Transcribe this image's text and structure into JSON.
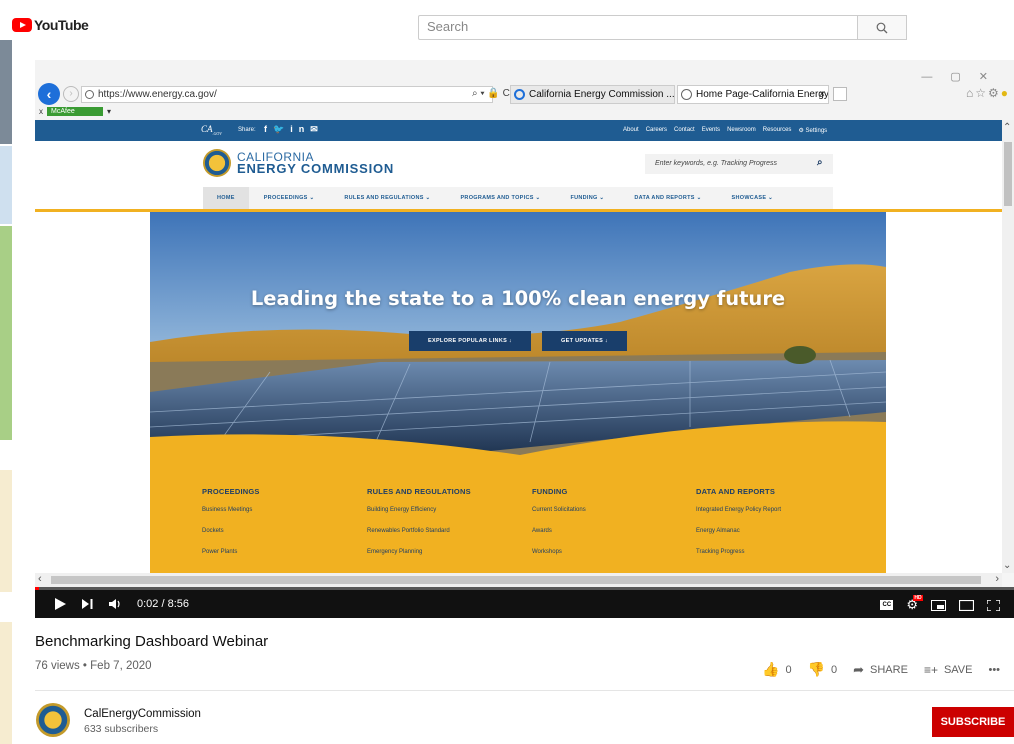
{
  "youtube": {
    "logo_text": "YouTube",
    "search_placeholder": "Search"
  },
  "browser": {
    "url": "https://www.energy.ca.gov/",
    "address_icons": "⌕ ▾ 🔒 C",
    "tabs": [
      {
        "label": "California Energy Commission ...",
        "active": false
      },
      {
        "label": "Home Page-California Energy...",
        "active": true
      }
    ],
    "close_tab_glyph": "×",
    "toolbar_x": "x",
    "mcafee_label": "McAfee"
  },
  "site": {
    "top_links": [
      "About",
      "Careers",
      "Contact",
      "Events",
      "Newsroom",
      "Resources",
      "Settings"
    ],
    "share_label": "Share:",
    "logo_line1": "CALIFORNIA",
    "logo_line2": "ENERGY COMMISSION",
    "search_placeholder": "Enter keywords, e.g. Tracking Progress",
    "nav": [
      "HOME",
      "PROCEEDINGS ⌄",
      "RULES AND REGULATIONS ⌄",
      "PROGRAMS AND TOPICS ⌄",
      "FUNDING ⌄",
      "DATA AND REPORTS ⌄",
      "SHOWCASE ⌄"
    ],
    "hero_title": "Leading the state to a 100% clean energy future",
    "hero_buttons": [
      "EXPLORE POPULAR LINKS ↓",
      "GET UPDATES ↓"
    ],
    "link_columns": [
      {
        "heading": "PROCEEDINGS",
        "links": [
          "Business Meetings",
          "Dockets",
          "Power Plants"
        ]
      },
      {
        "heading": "RULES AND REGULATIONS",
        "links": [
          "Building Energy Efficiency",
          "Renewables Portfolio Standard",
          "Emergency Planning"
        ]
      },
      {
        "heading": "FUNDING",
        "links": [
          "Current Solicitations",
          "Awards",
          "Workshops"
        ]
      },
      {
        "heading": "DATA AND REPORTS",
        "links": [
          "Integrated Energy Policy Report",
          "Energy Almanac",
          "Tracking Progress"
        ]
      }
    ],
    "colors": {
      "navy": "#1f5c92",
      "gold": "#f1b121",
      "dark_button": "#193e6b"
    }
  },
  "player": {
    "time": "0:02 / 8:56",
    "progress_fraction": 0.004
  },
  "video": {
    "title": "Benchmarking Dashboard Webinar",
    "meta": "76 views • Feb 7, 2020",
    "likes": "0",
    "dislikes": "0",
    "share_label": "SHARE",
    "save_label": "SAVE",
    "more_label": "•••"
  },
  "channel": {
    "name": "CalEnergyCommission",
    "subscribers": "633 subscribers",
    "subscribe_label": "SUBSCRIBE"
  }
}
